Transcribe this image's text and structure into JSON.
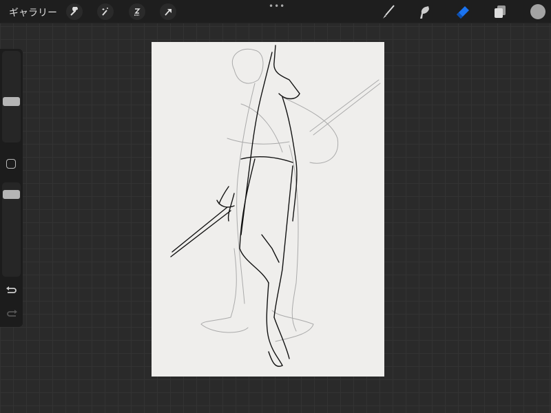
{
  "topbar": {
    "gallery_label": "ギャラリー",
    "more_label": "•••",
    "tools_left": [
      "wrench-icon",
      "magic-wand-icon",
      "selection-icon",
      "transform-arrow-icon"
    ],
    "tools_right": [
      "brush-icon",
      "smudge-icon",
      "eraser-icon",
      "layers-icon"
    ],
    "active_tool": "eraser",
    "accent_color": "#1a73f0",
    "current_color": "#a3a3a3"
  },
  "sidebar": {
    "brush_size": 0.44,
    "brush_opacity": 0.91
  },
  "canvas": {
    "background": "#efeeec"
  }
}
